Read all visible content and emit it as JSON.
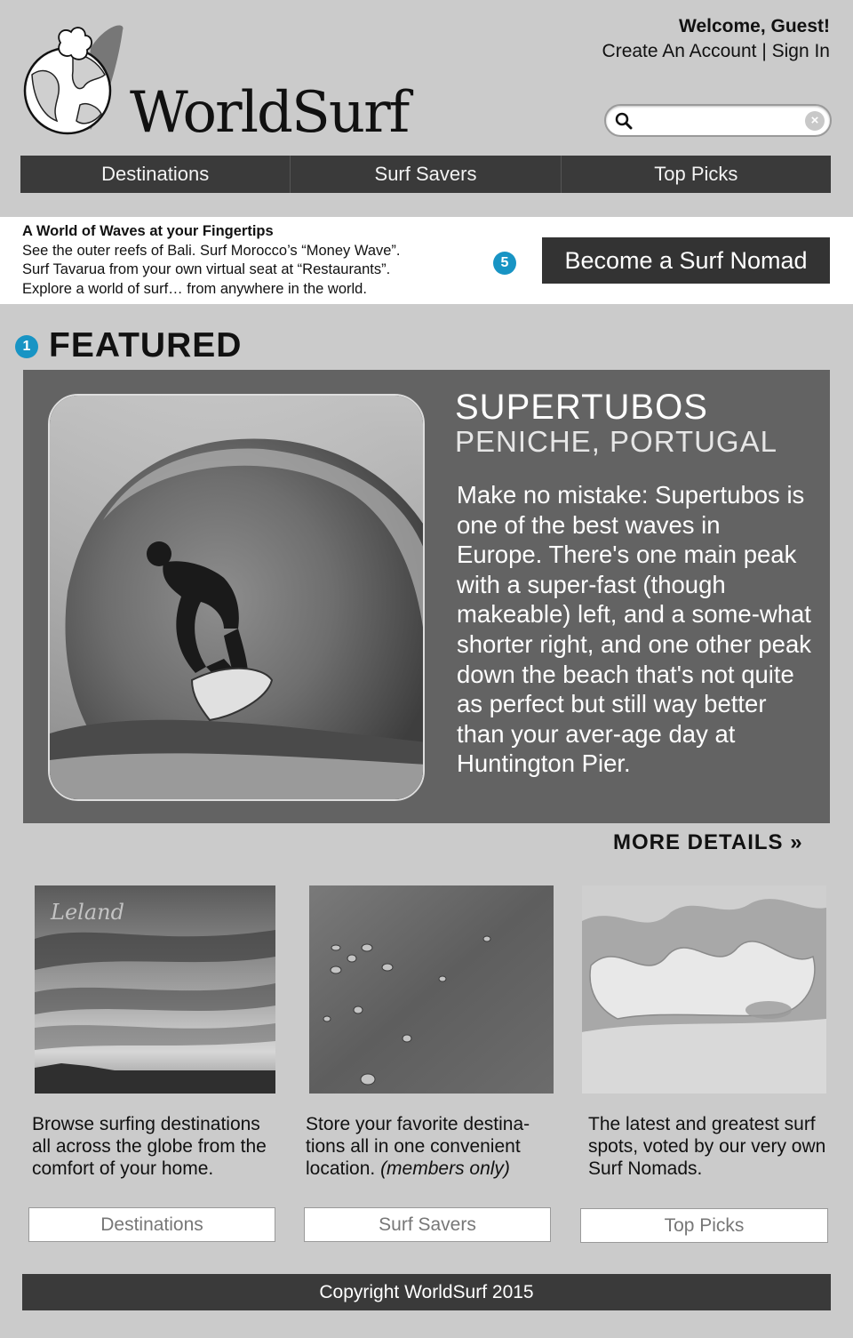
{
  "brand": {
    "name": "WorldSurf"
  },
  "account": {
    "welcome": "Welcome, Guest!",
    "create_account": "Create An Account",
    "separator": " | ",
    "sign_in": "Sign In"
  },
  "search": {
    "placeholder": "",
    "value": ""
  },
  "nav": {
    "items": [
      {
        "label": "Destinations"
      },
      {
        "label": "Surf Savers"
      },
      {
        "label": "Top Picks"
      }
    ]
  },
  "promo": {
    "title": "A World of Waves at your Fingertips",
    "lines": [
      "See the outer reefs of Bali. Surf Morocco’s “Money Wave”.",
      "Surf Tavarua from your own virtual seat at “Restaurants”.",
      "Explore a world of surf… from anywhere in the world."
    ],
    "badge": "5",
    "cta": "Become a Surf Nomad"
  },
  "featured": {
    "badge": "1",
    "heading": "FEATURED",
    "name": "SUPERTUBOS",
    "location": "PENICHE, PORTUGAL",
    "description": "Make no mistake: Supertubos is one of the best waves in Europe. There's one main peak with a super-fast (though makeable) left, and a some-what shorter right, and one other peak down the beach that's not quite as perfect but still way better than your aver-age day at Huntington Pier.",
    "more": "MORE DETAILS »"
  },
  "columns": [
    {
      "text": "Browse surfing destinations all across the globe from the comfort of your home.",
      "note": "",
      "button": "Destinations",
      "signature": "Leland"
    },
    {
      "text": "Store your favorite destina-tions all in one convenient location.",
      "note": "(members only)",
      "button": "Surf Savers"
    },
    {
      "text": "The latest and greatest surf spots, voted by our very own Surf Nomads.",
      "note": "",
      "button": "Top Picks"
    }
  ],
  "footer": {
    "copyright": "Copyright WorldSurf 2015"
  },
  "colors": {
    "page_bg": "#cbcbcb",
    "dark_bar": "#3a3a3a",
    "featured_bg": "#636363",
    "badge": "#1894c4"
  }
}
